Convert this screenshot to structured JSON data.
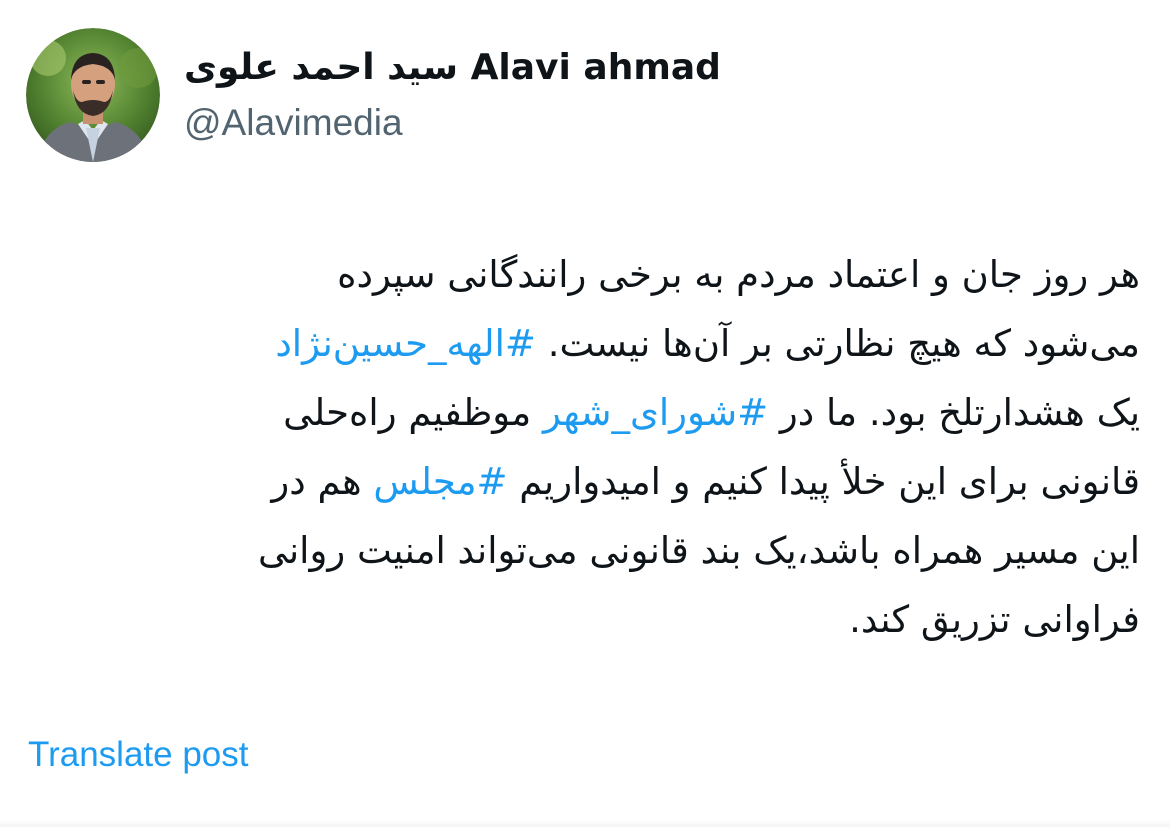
{
  "author": {
    "name": "سید احمد علوی Alavi ahmad",
    "handle": "@Alavimedia"
  },
  "post": {
    "lines": [
      {
        "segments": [
          {
            "text": "هر روز جان و اعتماد مردم به برخی رانندگانی سپرده",
            "hashtag": false
          }
        ]
      },
      {
        "segments": [
          {
            "text": "می‌شود که هیچ نظارتی بر آن‌ها نیست. ",
            "hashtag": false
          },
          {
            "text": "#الهه_حسین‌نژاد",
            "hashtag": true
          }
        ]
      },
      {
        "segments": [
          {
            "text": "یک هشدارتلخ بود. ما در ",
            "hashtag": false
          },
          {
            "text": "#شورای_شهر",
            "hashtag": true
          },
          {
            "text": " موظفیم راه‌حلی",
            "hashtag": false
          }
        ]
      },
      {
        "segments": [
          {
            "text": "قانونی برای این خلأ پیدا کنیم و امیدواریم ",
            "hashtag": false
          },
          {
            "text": "#مجلس",
            "hashtag": true
          },
          {
            "text": " هم در",
            "hashtag": false
          }
        ]
      },
      {
        "segments": [
          {
            "text": "این مسیر همراه باشد،یک بند قانونی می‌تواند امنیت روانی",
            "hashtag": false
          }
        ]
      },
      {
        "segments": [
          {
            "text": "فراوانی تزریق کند.",
            "hashtag": false
          }
        ]
      }
    ]
  },
  "actions": {
    "translate_label": "Translate post"
  },
  "colors": {
    "text": "#0f1419",
    "secondary": "#536471",
    "link": "#1d9bf0"
  },
  "icons": {
    "avatar": "profile-photo"
  }
}
